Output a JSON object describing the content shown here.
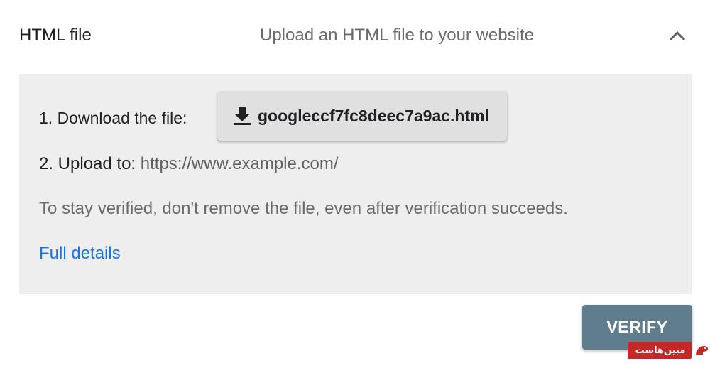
{
  "header": {
    "title": "HTML file",
    "subtitle": "Upload an HTML file to your website",
    "collapse_icon": "chevron-up-icon"
  },
  "panel": {
    "step1_label": "1. Download the file:",
    "download_button": {
      "icon": "download-icon",
      "label": "googleccf7fc8deec7a9ac.html"
    },
    "step2_label": "2. Upload to:",
    "step2_url": "https://www.example.com/",
    "note": "To stay verified, don't remove the file, even after verification succeeds.",
    "details_link": "Full details"
  },
  "actions": {
    "verify_label": "VERIFY"
  },
  "watermark": {
    "text": "مبین‌هاست"
  },
  "colors": {
    "panel_bg": "#eeeeee",
    "link": "#1a73e8",
    "verify_bg": "#5f7d8c",
    "watermark_bg": "#c62828"
  }
}
